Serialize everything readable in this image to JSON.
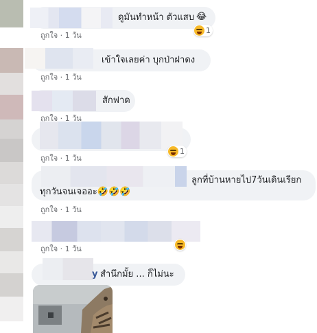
{
  "comments": [
    {
      "text": "ดูมันทำหน้า ตัวแสบ",
      "emoji_trail": "😂",
      "reaction_count": "1",
      "meta": "ถูกใจ · 1 วัน"
    },
    {
      "text": "เข้าใจเลยค่า บุกป่าฝาดง",
      "meta": "ถูกใจ · 1 วัน"
    },
    {
      "text": "สักฟาด",
      "meta": "ถูกใจ · 1 วัน"
    },
    {
      "text": "",
      "reaction_count": "1",
      "meta": "ถูกใจ · 1 วัน"
    },
    {
      "text": "ลูกที่บ้านหายไป7วันเดินเรียก",
      "text2": "ทุกวันจนเจออะ🤣🤣🤣",
      "meta": "ถูกใจ · 1 วัน"
    },
    {
      "text": "",
      "meta": "ถูกใจ · 1 วัน"
    },
    {
      "name_fragment": "y",
      "text": "สำนึกมั้ย ... ก็ไม่นะ"
    }
  ],
  "colors": {
    "bubble": "#f0f2f5",
    "meta": "#65676b",
    "text": "#1c1e21",
    "name": "#385898",
    "emoji": "#f7b928"
  },
  "icons": [
    "laugh-emoji-icon"
  ]
}
